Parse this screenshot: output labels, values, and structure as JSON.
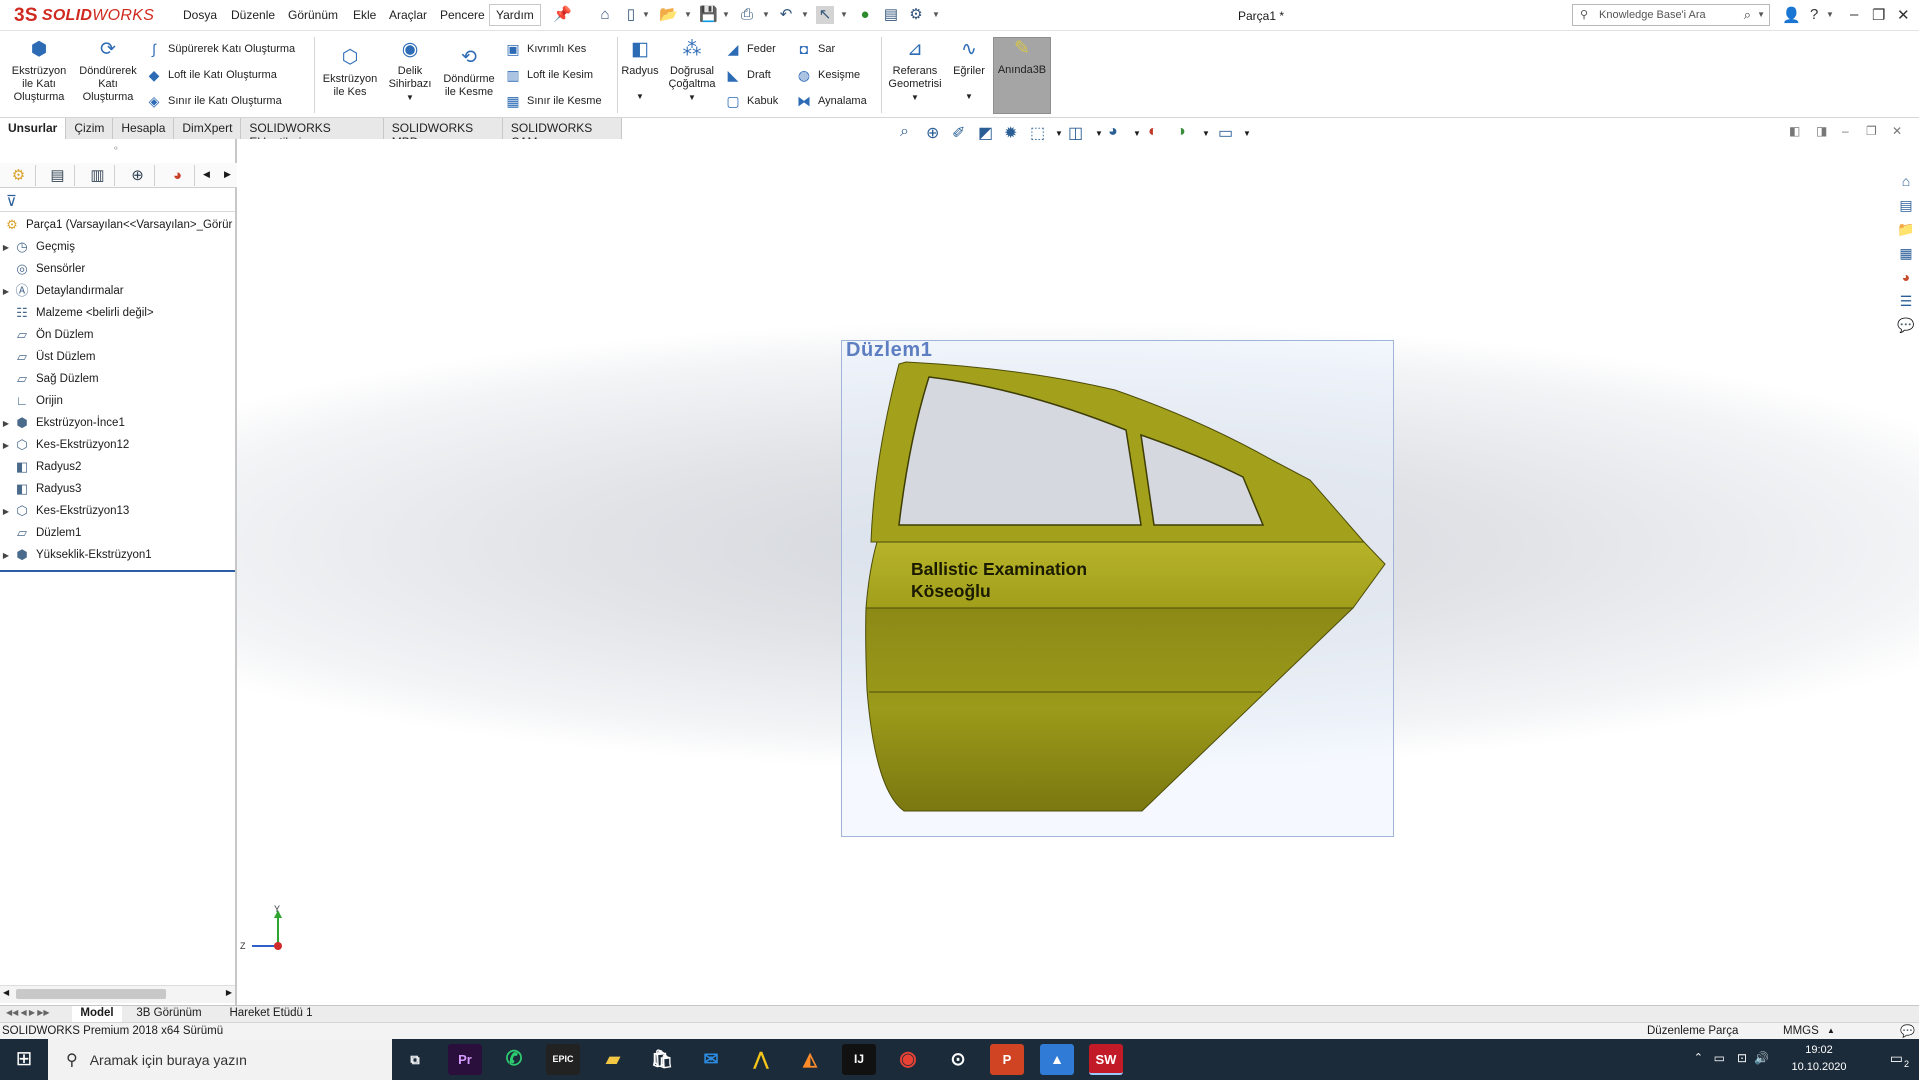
{
  "app": {
    "brand_prefix": "3S",
    "brand_a": "SOLID",
    "brand_b": "WORKS",
    "document_title": "Parça1 *"
  },
  "menus": [
    "Dosya",
    "Düzenle",
    "Görünüm",
    "Ekle",
    "Araçlar",
    "Pencere",
    "Yardım"
  ],
  "search": {
    "placeholder": "Knowledge Base'i Ara"
  },
  "ribbon": {
    "extrude_boss": "Ekstrüzyon ile Katı Oluşturma",
    "revolve_boss": "Döndürerek Katı Oluşturma",
    "sweep_boss": "Süpürerek Katı Oluşturma",
    "loft_boss": "Loft ile Katı Oluşturma",
    "boundary_boss": "Sınır ile Katı Oluşturma",
    "extrude_cut": "Ekstrüzyon ile Kes",
    "hole_wizard": "Delik Sihirbazı",
    "revolve_cut": "Döndürme ile Kesme",
    "swept_cut": "Kıvrımlı Kes",
    "loft_cut": "Loft ile Kesim",
    "boundary_cut": "Sınır ile Kesme",
    "fillet": "Radyus",
    "linear_pattern": "Doğrusal Çoğaltma",
    "rib": "Feder",
    "draft": "Draft",
    "shell": "Kabuk",
    "wrap": "Sar",
    "intersect": "Kesişme",
    "mirror": "Aynalama",
    "ref_geometry": "Referans Geometrisi",
    "curves": "Eğriler",
    "instant3d": "Anında3B"
  },
  "tabs": [
    "Unsurlar",
    "Çizim",
    "Hesapla",
    "DimXpert",
    "SOLIDWORKS Eklentileri",
    "SOLIDWORKS MBD",
    "SOLIDWORKS CAM"
  ],
  "tree": {
    "root": "Parça1  (Varsayılan<<Varsayılan>_Görür",
    "items": [
      {
        "label": "Geçmiş",
        "expandable": true,
        "icon": "history-icon"
      },
      {
        "label": "Sensörler",
        "expandable": false,
        "icon": "sensor-icon"
      },
      {
        "label": "Detaylandırmalar",
        "expandable": true,
        "icon": "annotations-icon"
      },
      {
        "label": "Malzeme <belirli değil>",
        "expandable": false,
        "icon": "material-icon"
      },
      {
        "label": "Ön Düzlem",
        "expandable": false,
        "icon": "plane-icon"
      },
      {
        "label": "Üst Düzlem",
        "expandable": false,
        "icon": "plane-icon"
      },
      {
        "label": "Sağ Düzlem",
        "expandable": false,
        "icon": "plane-icon"
      },
      {
        "label": "Orijin",
        "expandable": false,
        "icon": "origin-icon"
      },
      {
        "label": "Ekstrüzyon-İnce1",
        "expandable": true,
        "icon": "extrude-feature-icon"
      },
      {
        "label": "Kes-Ekstrüzyon12",
        "expandable": true,
        "icon": "cut-extrude-icon"
      },
      {
        "label": "Radyus2",
        "expandable": false,
        "icon": "fillet-icon"
      },
      {
        "label": "Radyus3",
        "expandable": false,
        "icon": "fillet-icon"
      },
      {
        "label": "Kes-Ekstrüzyon13",
        "expandable": true,
        "icon": "cut-extrude-icon"
      },
      {
        "label": "Düzlem1",
        "expandable": false,
        "icon": "plane-icon"
      },
      {
        "label": "Yükseklik-Ekstrüzyon1",
        "expandable": true,
        "icon": "boss-extrude-icon"
      }
    ]
  },
  "viewport": {
    "plane_label": "Düzlem1",
    "text_line1": "Ballistic Examination",
    "text_line2": "Köseoğlu",
    "triad_y": "Y",
    "triad_z": "Z"
  },
  "bottom_tabs": [
    "Model",
    "3B Görünüm",
    "Hareket Etüdü 1"
  ],
  "status": {
    "left": "SOLIDWORKS Premium 2018 x64 Sürümü",
    "mode": "Düzenleme Parça",
    "units": "MMGS"
  },
  "taskbar": {
    "search_placeholder": "Aramak için buraya yazın",
    "time": "19:02",
    "date": "10.10.2020",
    "notification_count": "2"
  },
  "colors": {
    "brand": "#d02a20",
    "door": "#a6a31c",
    "plane_border": "#9fb4d8",
    "taskbar": "#1c2b3a"
  }
}
